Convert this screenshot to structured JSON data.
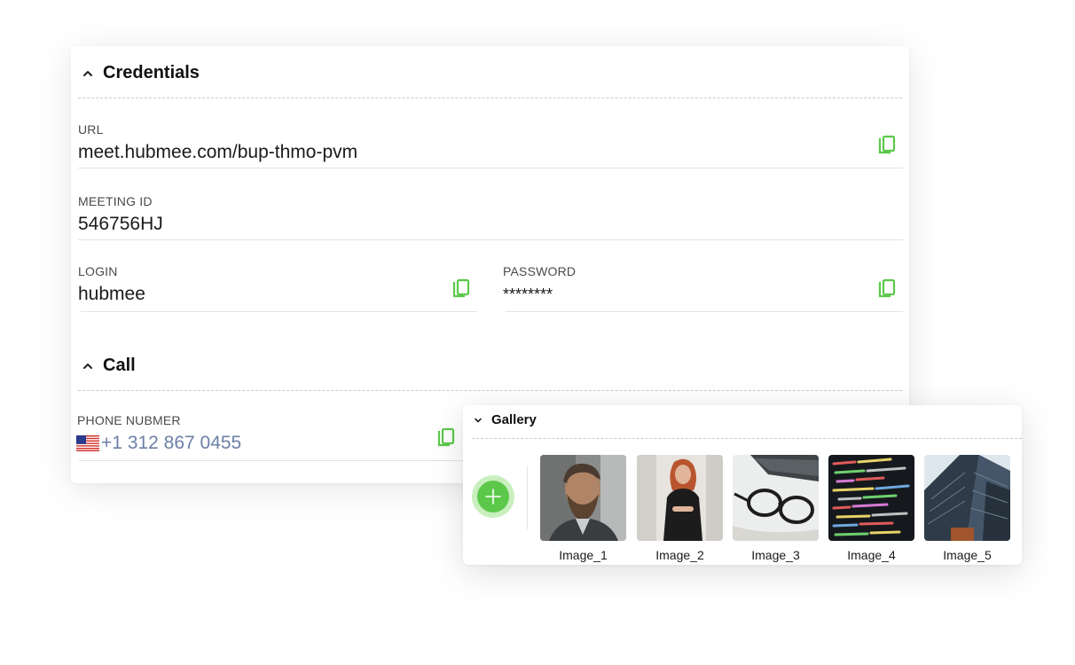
{
  "credentials": {
    "title": "Credentials",
    "url_label": "URL",
    "url_value": "meet.hubmee.com/bup-thmo-pvm",
    "meeting_id_label": "MEETING ID",
    "meeting_id_value": "546756HJ",
    "login_label": "LOGIN",
    "login_value": "hubmee",
    "password_label": "PASSWORD",
    "password_value": "********"
  },
  "call": {
    "title": "Call",
    "phone_label": "PHONE NUBMER",
    "phone_value": "+1 312 867 0455",
    "phone_flag": "us-flag-icon"
  },
  "gallery": {
    "title": "Gallery",
    "add_icon": "plus-icon",
    "images": [
      {
        "label": "Image_1"
      },
      {
        "label": "Image_2"
      },
      {
        "label": "Image_3"
      },
      {
        "label": "Image_4"
      },
      {
        "label": "Image_5"
      }
    ]
  },
  "colors": {
    "accent_green": "#5cc84a",
    "phone_text": "#6c7fa6"
  }
}
